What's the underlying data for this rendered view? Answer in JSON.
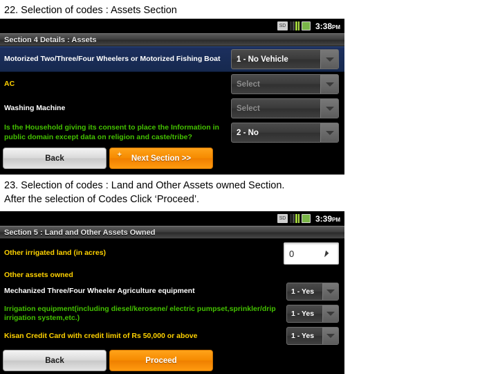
{
  "captions": {
    "first": "22. Selection of  codes : Assets Section",
    "second": "23. Selection of  codes : Land and Other Assets owned Section.\nAfter the selection of Codes Click ‘Proceed’."
  },
  "screen_one": {
    "statusbar": {
      "sd_icon": "sd-card-icon",
      "sd_text": "SD",
      "signal_icon": "signal-bars-icon",
      "battery_icon": "battery-icon",
      "time": "3:38",
      "ampm": "PM"
    },
    "title": "Section 4 Details : Assets",
    "rows": [
      {
        "label": "Motorized Two/Three/Four Wheelers\nor Motorized Fishing Boat",
        "label_color": "white",
        "highlight": true,
        "value": "1 - No Vehicle",
        "placeholder": false
      },
      {
        "label": "AC",
        "label_color": "yellow",
        "highlight": false,
        "value": "Select",
        "placeholder": true
      },
      {
        "label": "Washing Machine",
        "label_color": "white",
        "highlight": false,
        "value": "Select",
        "placeholder": true
      },
      {
        "label": "Is the Household giving its consent to place\nthe Information in public domain except data\non religion and caste/tribe?",
        "label_color": "green",
        "highlight": false,
        "value": "2 - No",
        "placeholder": false
      }
    ],
    "buttons": {
      "back": "Back",
      "next": "Next Section >>"
    }
  },
  "screen_two": {
    "statusbar": {
      "sd_icon": "sd-card-icon",
      "sd_text": "SD",
      "signal_icon": "signal-bars-icon",
      "battery_icon": "battery-icon",
      "time": "3:39",
      "ampm": "PM"
    },
    "title": "Section 5 : Land and Other Assets Owned",
    "first_row": {
      "label": "Other irrigated land (in acres)",
      "value": "0"
    },
    "section_label": "Other assets owned",
    "rows": [
      {
        "label": "Mechanized Three/Four Wheeler Agriculture\nequipment",
        "label_color": "white",
        "value": "1 - Yes"
      },
      {
        "label": "Irrigation equipment(including diesel/kerosene/\nelectric pumpset,sprinkler/drip irrigation system,etc.)",
        "label_color": "green",
        "value": "1 - Yes"
      },
      {
        "label": "Kisan Credit Card with credit limit of Rs 50,000 or above",
        "label_color": "yellow",
        "value": "1 - Yes"
      }
    ],
    "buttons": {
      "back": "Back",
      "proceed": "Proceed"
    }
  }
}
